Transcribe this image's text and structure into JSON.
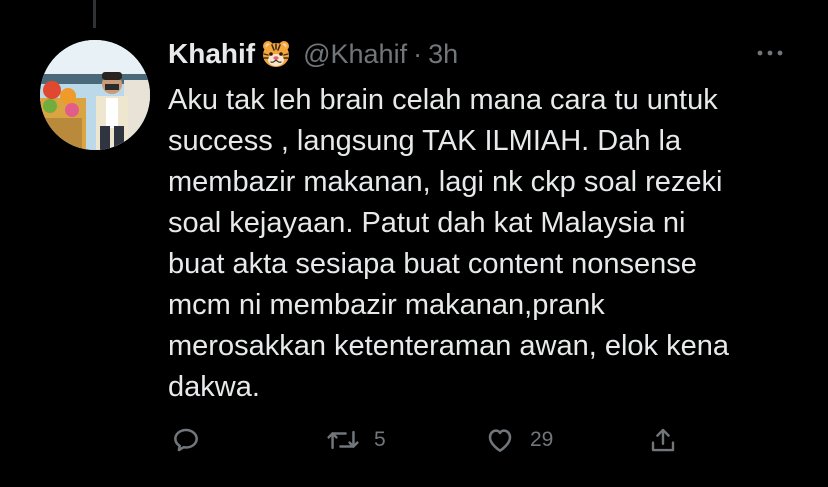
{
  "tweet": {
    "display_name": "Khahif",
    "handle": "@Khahif",
    "separator": "·",
    "timestamp": "3h",
    "badge_icon": "tiger-face-icon",
    "text": "Aku tak leh brain celah mana cara tu untuk\nsuccess , langsung TAK ILMIAH. Dah la\nmembazir makanan, lagi nk ckp soal rezeki\nsoal kejayaan. Patut dah kat Malaysia ni\nbuat akta sesiapa buat content nonsense\nmcm ni membazir makanan,prank\nmerosakkan ketenteraman awan, elok kena\ndakwa."
  },
  "actions": {
    "reply_icon": "reply-icon",
    "retweet_icon": "retweet-icon",
    "retweet_count": "5",
    "like_icon": "heart-icon",
    "like_count": "29",
    "share_icon": "share-icon"
  },
  "theme": {
    "background": "#000000",
    "primary_text": "#e7e9ea",
    "secondary_text": "#71767b"
  }
}
